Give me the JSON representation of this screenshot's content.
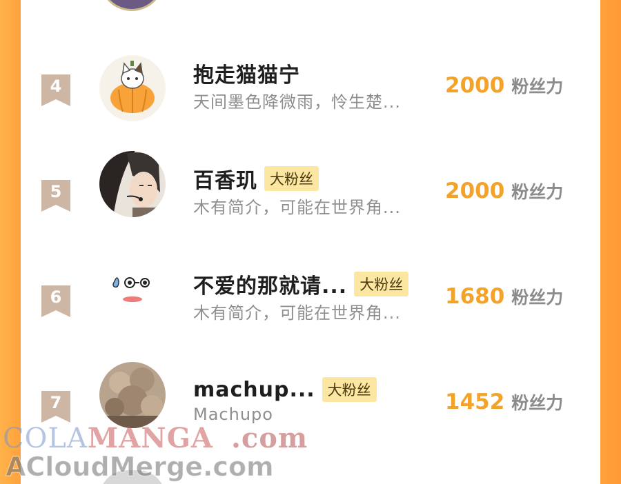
{
  "colors": {
    "background": "#ffa23c",
    "panel": "#ffffff",
    "score": "#f3a32a",
    "badge_bg": "#fbe7a2",
    "rank_badge": "#cdb7a4"
  },
  "unit_label": "粉丝力",
  "rows": [
    {
      "rank": "4",
      "name": "抱走猫猫宁",
      "badge": "",
      "description": "天间墨色降微雨，怜生楚...",
      "score": "2000",
      "avatar_icon": "pumpkin-cat-icon"
    },
    {
      "rank": "5",
      "name": "百香玑",
      "badge": "大粉丝",
      "description": "木有简介，可能在世界角...",
      "score": "2000",
      "avatar_icon": "anime-boy-headset-icon"
    },
    {
      "rank": "6",
      "name": "不爱的那就请...",
      "badge": "大粉丝",
      "description": "木有简介，可能在世界角...",
      "score": "1680",
      "avatar_icon": "doodle-face-icon"
    },
    {
      "rank": "7",
      "name": "machup...",
      "badge": "大粉丝",
      "description": "Machupo",
      "score": "1452",
      "avatar_icon": "furry-dog-icon"
    }
  ],
  "watermark": {
    "line1_part_a": "COLA",
    "line1_part_b": "MANGA",
    "line1_part_c": ".com",
    "line2": "ACloudMerge.com"
  }
}
